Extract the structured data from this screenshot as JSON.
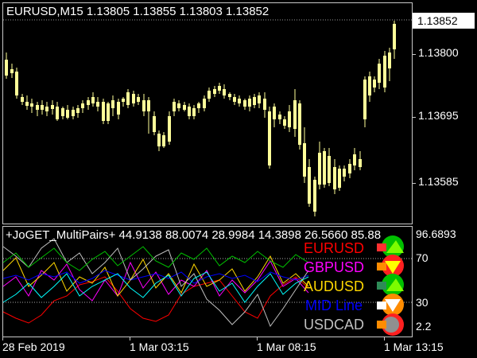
{
  "main": {
    "symbol_header": "EURUSD,M15  1.13805 1.13855 1.13803 1.13852",
    "current_price": "1.13852",
    "price_axis": [
      "1.13800",
      "1.13695",
      "1.13585"
    ],
    "candle_color": "#ffff99"
  },
  "indicator": {
    "header": "+JoGET_MultiPairs+ 44.9138 88.0074 28.9984 14.3898 26.5660 85.88",
    "axis_top": "96.6893",
    "levels": [
      "70",
      "30",
      "2.2"
    ],
    "pairs": [
      {
        "label": "EURUSD",
        "color": "#ff0000",
        "icon": "green-up-arrow-icon"
      },
      {
        "label": "GBPUSD",
        "color": "#ff00ff",
        "icon": "red-down-arrow-icon"
      },
      {
        "label": "AUDUSD",
        "color": "#ffd700",
        "icon": "green-up-arrow-icon"
      },
      {
        "label": "MID Line",
        "color": "#0000ff",
        "icon": "orange-down-arrow-icon"
      },
      {
        "label": "USDCAD",
        "color": "#c0c0c0",
        "icon": "gray-neutral-icon"
      }
    ]
  },
  "time_axis": [
    "28 Feb 2019",
    "1 Mar 03:15",
    "1 Mar 08:15",
    "1 Mar 13:15"
  ]
}
